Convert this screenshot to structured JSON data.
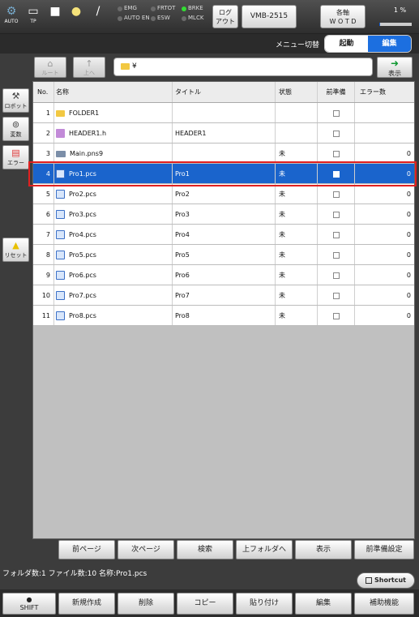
{
  "topbar": {
    "icons": [
      {
        "icon": "robot-arm-icon",
        "caption": "AUTO"
      },
      {
        "icon": "teach-pendant-icon",
        "caption": "TP"
      },
      {
        "icon": "stop-square-icon",
        "caption": ""
      },
      {
        "icon": "lightbulb-icon",
        "caption": ""
      },
      {
        "icon": "wrench-icon",
        "caption": ""
      }
    ],
    "indicators": [
      {
        "label": "EMG",
        "on": false
      },
      {
        "label": "AUTO EN",
        "on": false
      },
      {
        "label": "FRTOT",
        "on": false
      },
      {
        "label": "ESW",
        "on": false
      },
      {
        "label": "BRKE",
        "on": true
      },
      {
        "label": "MLCK",
        "on": false
      }
    ],
    "logout_label_1": "ログ",
    "logout_label_2": "アウト",
    "model_label": "VMB-2515",
    "axis_label_1": "各軸",
    "axis_label_2": "W O T D",
    "speed_label": "1 %",
    "speed_fraction": 0.01
  },
  "menubar": {
    "label": "メニュー切替",
    "options": [
      "起動",
      "編集"
    ],
    "active": "編集"
  },
  "nav": {
    "root_label": "ルート",
    "up_label": "上へ",
    "path": "¥",
    "show_label": "表示"
  },
  "side": {
    "robot_label": "ロボット",
    "var_label": "変数",
    "error_label": "エラー",
    "reset_label": "リセット"
  },
  "table": {
    "columns": [
      "No.",
      "名称",
      "タイトル",
      "状態",
      "前準備",
      "エラー数"
    ],
    "rows": [
      {
        "no": "1",
        "icon": "folder",
        "name": "FOLDER1",
        "title": "",
        "state": "",
        "prep": true,
        "errors": ""
      },
      {
        "no": "2",
        "icon": "h",
        "name": "HEADER1.h",
        "title": "HEADER1",
        "state": "",
        "prep": true,
        "errors": ""
      },
      {
        "no": "3",
        "icon": "main",
        "name": "Main.pns9",
        "title": "",
        "state": "未",
        "prep": true,
        "errors": "0"
      },
      {
        "no": "4",
        "icon": "pcs",
        "name": "Pro1.pcs",
        "title": "Pro1",
        "state": "未",
        "prep": true,
        "errors": "0",
        "selected": true
      },
      {
        "no": "5",
        "icon": "pcs",
        "name": "Pro2.pcs",
        "title": "Pro2",
        "state": "未",
        "prep": true,
        "errors": "0"
      },
      {
        "no": "6",
        "icon": "pcs",
        "name": "Pro3.pcs",
        "title": "Pro3",
        "state": "未",
        "prep": true,
        "errors": "0"
      },
      {
        "no": "7",
        "icon": "pcs",
        "name": "Pro4.pcs",
        "title": "Pro4",
        "state": "未",
        "prep": true,
        "errors": "0"
      },
      {
        "no": "8",
        "icon": "pcs",
        "name": "Pro5.pcs",
        "title": "Pro5",
        "state": "未",
        "prep": true,
        "errors": "0"
      },
      {
        "no": "9",
        "icon": "pcs",
        "name": "Pro6.pcs",
        "title": "Pro6",
        "state": "未",
        "prep": true,
        "errors": "0"
      },
      {
        "no": "10",
        "icon": "pcs",
        "name": "Pro7.pcs",
        "title": "Pro7",
        "state": "未",
        "prep": true,
        "errors": "0"
      },
      {
        "no": "11",
        "icon": "pcs",
        "name": "Pro8.pcs",
        "title": "Pro8",
        "state": "未",
        "prep": true,
        "errors": "0"
      }
    ]
  },
  "actions": [
    "前ページ",
    "次ページ",
    "検索",
    "上フォルダへ",
    "表示",
    "前準備設定"
  ],
  "status": {
    "text": "フォルダ数:1  ファイル数:10  名称:Pro1.pcs",
    "shortcut_label": "Shortcut"
  },
  "bottom": {
    "shift_label": "SHIFT",
    "buttons": [
      "新規作成",
      "削除",
      "コピー",
      "貼り付け",
      "編集",
      "補助機能"
    ]
  },
  "colors": {
    "accent": "#1a64cc",
    "led_on": "#33dd33",
    "highlight": "#e02020"
  }
}
